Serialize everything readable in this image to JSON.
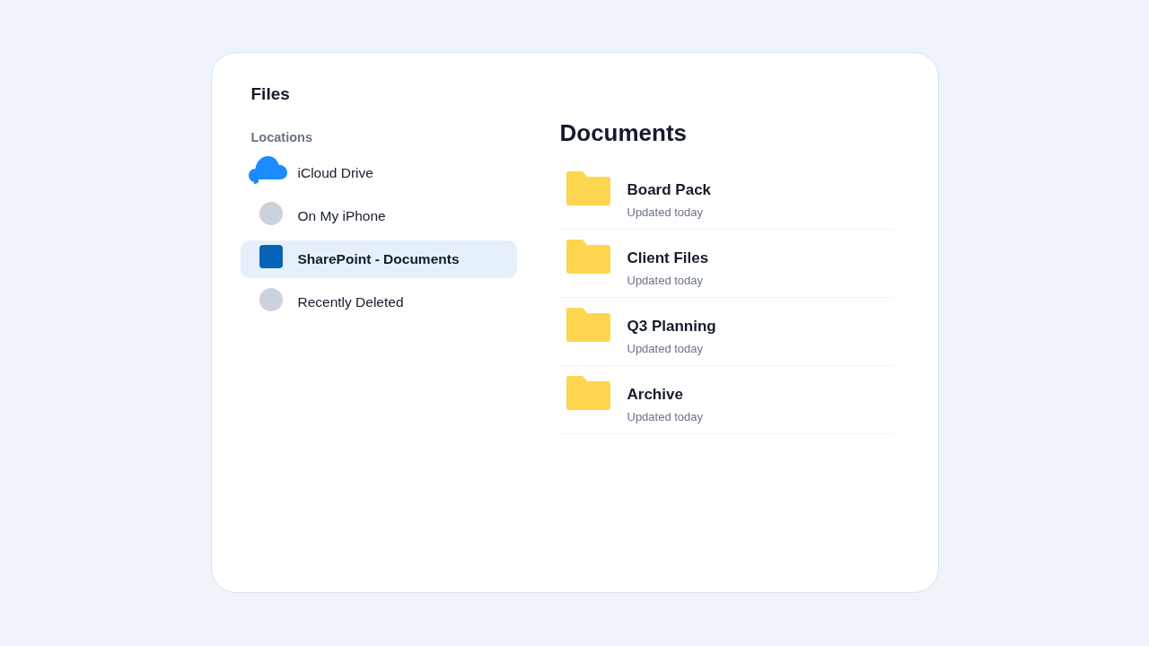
{
  "sidebar": {
    "title": "Files",
    "section_label": "Locations",
    "items": [
      {
        "label": "iCloud Drive",
        "kind": "cloud",
        "selected": false
      },
      {
        "label": "On My iPhone",
        "kind": "circle",
        "selected": false
      },
      {
        "label": "SharePoint - Documents",
        "kind": "square",
        "selected": true
      },
      {
        "label": "Recently Deleted",
        "kind": "circle",
        "selected": false
      }
    ]
  },
  "content": {
    "title": "Documents",
    "folders": [
      {
        "name": "Board Pack",
        "subtitle": "Updated today"
      },
      {
        "name": "Client Files",
        "subtitle": "Updated today"
      },
      {
        "name": "Q3 Planning",
        "subtitle": "Updated today"
      },
      {
        "name": "Archive",
        "subtitle": "Updated today"
      }
    ]
  }
}
